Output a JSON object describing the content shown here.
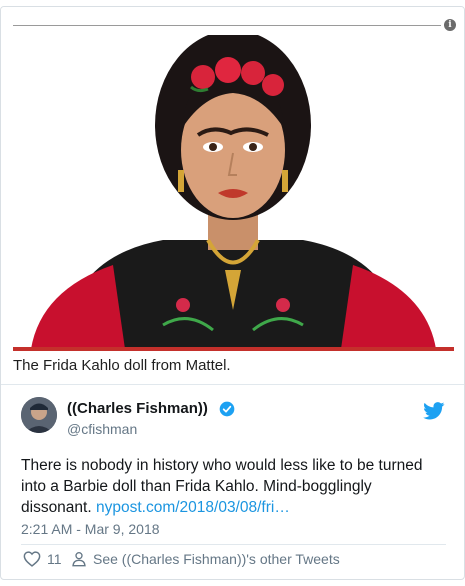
{
  "media": {
    "caption": "The Frida Kahlo doll from Mattel."
  },
  "tweet": {
    "display_name": "((Charles Fishman))",
    "handle": "@cfishman",
    "text": "There is nobody in history who would less like to be turned into a Barbie doll than Frida Kahlo. Mind-bogglingly dissonant. ",
    "link_text": "nypost.com/2018/03/08/fri…",
    "timestamp": "2:21 AM - Mar 9, 2018",
    "like_count": "11",
    "see_others": "See ((Charles Fishman))'s other Tweets"
  },
  "colors": {
    "accent": "#1da1f2",
    "link": "#1b95e0",
    "caption_bar": "#c4302b",
    "muted": "#657786"
  },
  "icons": [
    "info-icon",
    "verified-badge-icon",
    "twitter-bird-icon",
    "heart-icon",
    "person-icon"
  ]
}
